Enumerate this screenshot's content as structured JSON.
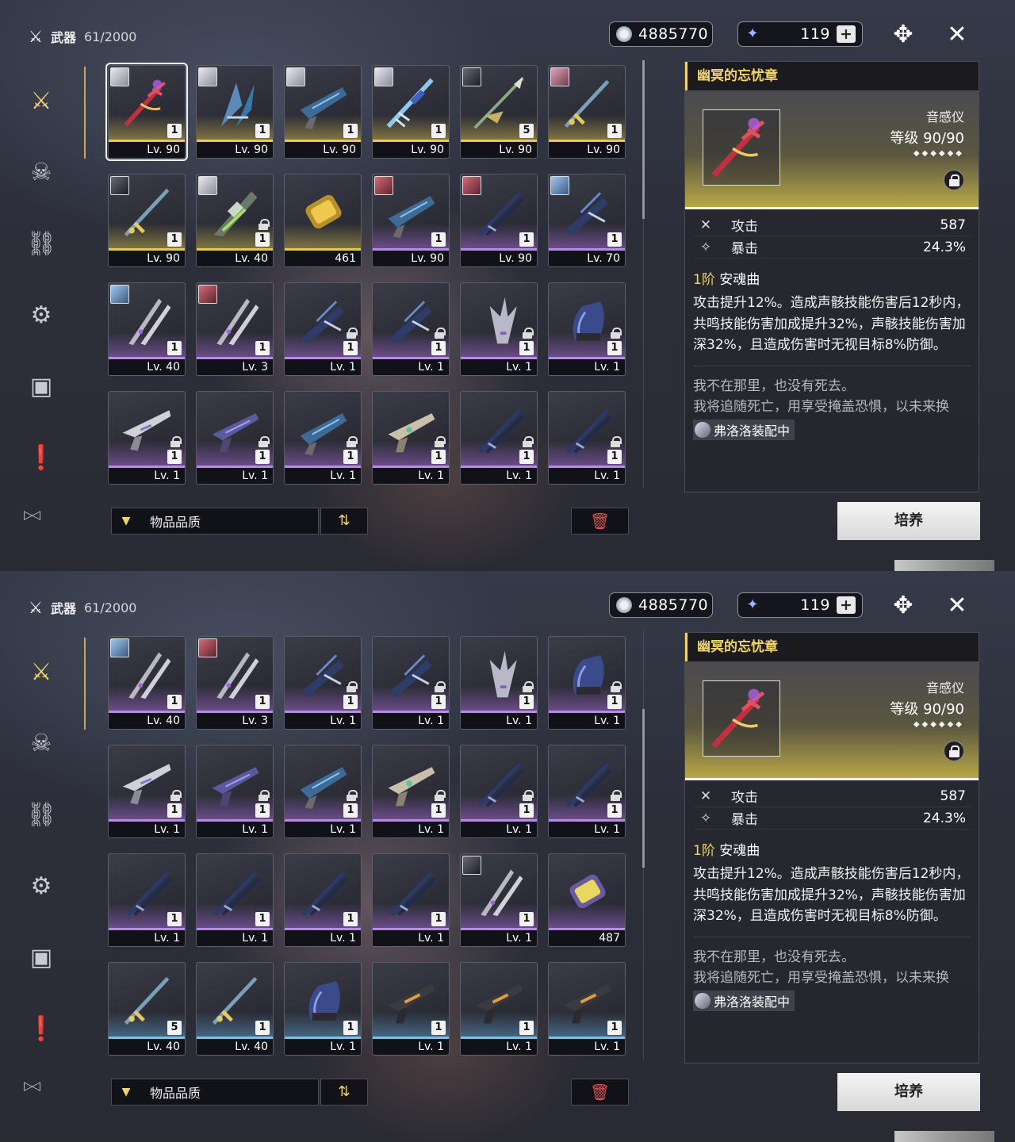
{
  "panels": [
    {
      "header": {
        "title": "武器",
        "count": "61/2000"
      },
      "currency": [
        {
          "icon": "coin-icon",
          "value": "4885770"
        },
        {
          "icon": "star-shard-icon",
          "value": "119"
        }
      ],
      "slots": [
        {
          "avatar": "white",
          "q": "q5",
          "count": "1",
          "label": "Lv. 90",
          "lock": false,
          "sel": true,
          "w": "sword-red"
        },
        {
          "avatar": "white",
          "q": "q5",
          "count": "1",
          "label": "Lv. 90",
          "lock": false,
          "w": "blade-blue"
        },
        {
          "avatar": "white",
          "q": "q5",
          "count": "1",
          "label": "Lv. 90",
          "lock": false,
          "w": "gun-blue"
        },
        {
          "avatar": "white",
          "q": "q5",
          "count": "1",
          "label": "Lv. 90",
          "lock": false,
          "w": "sword-ice"
        },
        {
          "avatar": "dark",
          "q": "q5",
          "count": "5",
          "label": "Lv. 90",
          "lock": false,
          "w": "spear-green"
        },
        {
          "avatar": "pink",
          "q": "q5",
          "count": "1",
          "label": "Lv. 90",
          "lock": false,
          "w": "sword-gold"
        },
        {
          "avatar": "dark",
          "q": "q5",
          "count": "1",
          "label": "Lv. 90",
          "lock": false,
          "w": "sword-gold"
        },
        {
          "avatar": "white",
          "q": "q5",
          "count": "1",
          "label": "Lv. 40",
          "lock": true,
          "w": "blade-green"
        },
        {
          "avatar": "",
          "q": "q5",
          "count": "",
          "label": "461",
          "lock": false,
          "w": "capsule-gold"
        },
        {
          "avatar": "red",
          "q": "q4",
          "count": "1",
          "label": "Lv. 90",
          "lock": false,
          "w": "gun-blue"
        },
        {
          "avatar": "red",
          "q": "q4",
          "count": "1",
          "label": "Lv. 90",
          "lock": false,
          "w": "sword-dark"
        },
        {
          "avatar": "blue",
          "q": "q4",
          "count": "1",
          "label": "Lv. 70",
          "lock": false,
          "w": "blade-dark"
        },
        {
          "avatar": "blue",
          "q": "q4",
          "count": "1",
          "label": "Lv. 40",
          "lock": false,
          "w": "blades-twin"
        },
        {
          "avatar": "red",
          "q": "q4",
          "count": "1",
          "label": "Lv. 3",
          "lock": false,
          "w": "blades-twin"
        },
        {
          "avatar": "",
          "q": "q4",
          "count": "1",
          "label": "Lv. 1",
          "lock": true,
          "w": "blade-dark"
        },
        {
          "avatar": "",
          "q": "q4",
          "count": "1",
          "label": "Lv. 1",
          "lock": true,
          "w": "blade-dark"
        },
        {
          "avatar": "",
          "q": "q4",
          "count": "1",
          "label": "Lv. 1",
          "lock": true,
          "w": "blade-fan"
        },
        {
          "avatar": "",
          "q": "q4",
          "count": "1",
          "label": "Lv. 1",
          "lock": true,
          "w": "gauntlet"
        },
        {
          "avatar": "",
          "q": "q4",
          "count": "1",
          "label": "Lv. 1",
          "lock": true,
          "w": "gun-white"
        },
        {
          "avatar": "",
          "q": "q4",
          "count": "1",
          "label": "Lv. 1",
          "lock": true,
          "w": "gun-purple"
        },
        {
          "avatar": "",
          "q": "q4",
          "count": "1",
          "label": "Lv. 1",
          "lock": true,
          "w": "gun-blue"
        },
        {
          "avatar": "",
          "q": "q4",
          "count": "1",
          "label": "Lv. 1",
          "lock": true,
          "w": "gun-beige"
        },
        {
          "avatar": "",
          "q": "q4",
          "count": "1",
          "label": "Lv. 1",
          "lock": true,
          "w": "sword-dark"
        },
        {
          "avatar": "",
          "q": "q4",
          "count": "1",
          "label": "Lv. 1",
          "lock": true,
          "w": "sword-dark"
        }
      ]
    },
    {
      "header": {
        "title": "武器",
        "count": "61/2000"
      },
      "currency": [
        {
          "icon": "coin-icon",
          "value": "4885770"
        },
        {
          "icon": "star-shard-icon",
          "value": "119"
        }
      ],
      "slots": [
        {
          "avatar": "blue",
          "q": "q4",
          "count": "1",
          "label": "Lv. 40",
          "lock": false,
          "w": "blades-twin"
        },
        {
          "avatar": "red",
          "q": "q4",
          "count": "1",
          "label": "Lv. 3",
          "lock": false,
          "w": "blades-twin"
        },
        {
          "avatar": "",
          "q": "q4",
          "count": "1",
          "label": "Lv. 1",
          "lock": true,
          "w": "blade-dark"
        },
        {
          "avatar": "",
          "q": "q4",
          "count": "1",
          "label": "Lv. 1",
          "lock": true,
          "w": "blade-dark"
        },
        {
          "avatar": "",
          "q": "q4",
          "count": "1",
          "label": "Lv. 1",
          "lock": true,
          "w": "blade-fan"
        },
        {
          "avatar": "",
          "q": "q4",
          "count": "1",
          "label": "Lv. 1",
          "lock": true,
          "w": "gauntlet"
        },
        {
          "avatar": "",
          "q": "q4",
          "count": "1",
          "label": "Lv. 1",
          "lock": true,
          "w": "gun-white"
        },
        {
          "avatar": "",
          "q": "q4",
          "count": "1",
          "label": "Lv. 1",
          "lock": true,
          "w": "gun-purple"
        },
        {
          "avatar": "",
          "q": "q4",
          "count": "1",
          "label": "Lv. 1",
          "lock": true,
          "w": "gun-blue"
        },
        {
          "avatar": "",
          "q": "q4",
          "count": "1",
          "label": "Lv. 1",
          "lock": true,
          "w": "gun-beige"
        },
        {
          "avatar": "",
          "q": "q4",
          "count": "1",
          "label": "Lv. 1",
          "lock": true,
          "w": "sword-dark"
        },
        {
          "avatar": "",
          "q": "q4",
          "count": "1",
          "label": "Lv. 1",
          "lock": true,
          "w": "sword-dark"
        },
        {
          "avatar": "",
          "q": "q4",
          "count": "1",
          "label": "Lv. 1",
          "lock": false,
          "w": "sword-dark"
        },
        {
          "avatar": "",
          "q": "q4",
          "count": "1",
          "label": "Lv. 1",
          "lock": false,
          "w": "sword-dark"
        },
        {
          "avatar": "",
          "q": "q4",
          "count": "1",
          "label": "Lv. 1",
          "lock": false,
          "w": "sword-dark"
        },
        {
          "avatar": "",
          "q": "q4",
          "count": "1",
          "label": "Lv. 1",
          "lock": false,
          "w": "sword-dark"
        },
        {
          "avatar": "dark",
          "q": "q4",
          "count": "1",
          "label": "Lv. 1",
          "lock": false,
          "w": "blades-twin"
        },
        {
          "avatar": "",
          "q": "q4",
          "count": "",
          "label": "487",
          "lock": false,
          "w": "capsule-purple"
        },
        {
          "avatar": "",
          "q": "q3",
          "count": "5",
          "label": "Lv. 40",
          "lock": false,
          "w": "sword-gold"
        },
        {
          "avatar": "",
          "q": "q3",
          "count": "1",
          "label": "Lv. 40",
          "lock": false,
          "w": "sword-gold"
        },
        {
          "avatar": "",
          "q": "q3",
          "count": "1",
          "label": "Lv. 1",
          "lock": false,
          "w": "gauntlet"
        },
        {
          "avatar": "",
          "q": "q3",
          "count": "1",
          "label": "Lv. 1",
          "lock": false,
          "w": "gun-dark"
        },
        {
          "avatar": "",
          "q": "q3",
          "count": "1",
          "label": "Lv. 1",
          "lock": false,
          "w": "gun-dark"
        },
        {
          "avatar": "",
          "q": "q3",
          "count": "1",
          "label": "Lv. 1",
          "lock": false,
          "w": "gun-dark"
        }
      ]
    }
  ],
  "filter": {
    "label": "物品品质",
    "sort_icon": "sort-icon",
    "delete_icon": "trash-icon"
  },
  "sidebar": [
    "weapon-icon",
    "echo-icon",
    "chain-icon",
    "synth-icon",
    "supply-icon",
    "quest-icon"
  ],
  "detail": {
    "name": "幽冥的忘忧章",
    "type": "音感仪",
    "level_label": "等级",
    "level": "90/90",
    "stars": "◆◆◆◆◆◆",
    "stats": [
      {
        "icon": "attack-icon",
        "key": "攻击",
        "value": "587"
      },
      {
        "icon": "crit-icon",
        "key": "暴击",
        "value": "24.3%"
      }
    ],
    "skill_rank": "1阶",
    "skill_name": "安魂曲",
    "skill_desc": "攻击提升12%。造成声骸技能伤害后12秒内，共鸣技能伤害加成提升32%，声骸技能伤害加深32%，且造成伤害时无视目标8%防御。",
    "lore_1": "我不在那里，也没有死去。",
    "lore_2": "我将追随死亡，用享受掩盖恐惧，以未来换",
    "equipped": "弗洛洛装配中"
  },
  "cultivate_label": "培养",
  "colors": {
    "accent": "#f0d36a",
    "q5": "#e6c955",
    "q4": "#b88be6",
    "q3": "#7ec0e8"
  }
}
